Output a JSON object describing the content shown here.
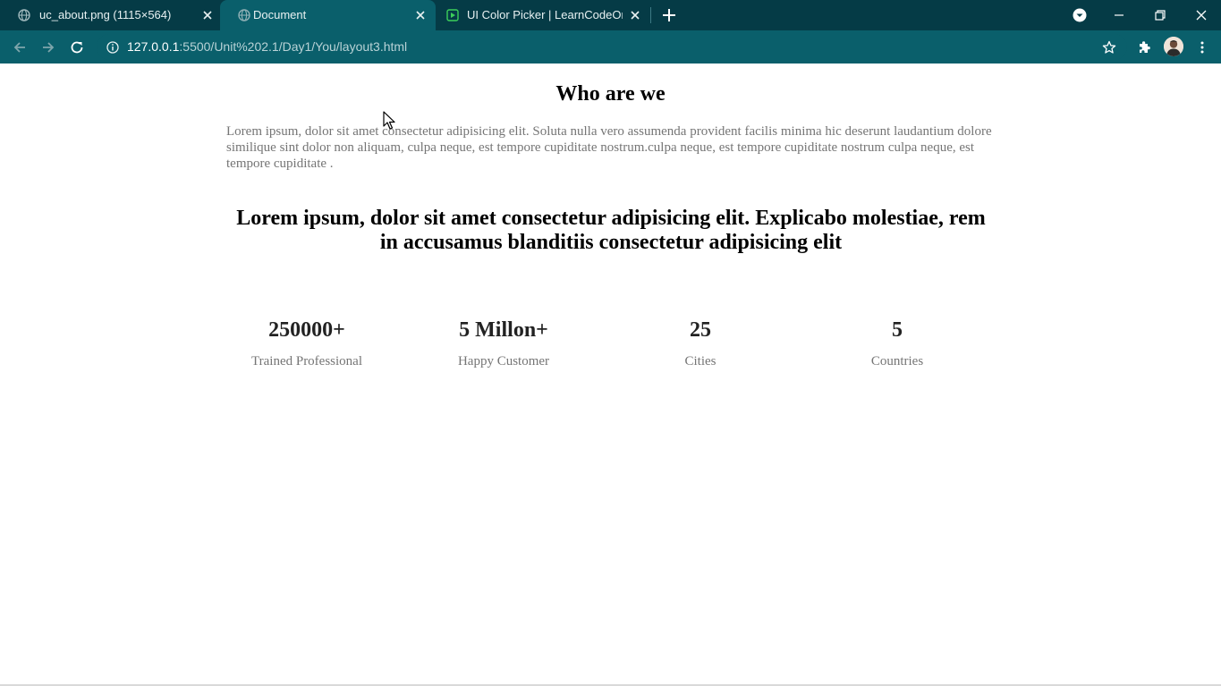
{
  "tabs": [
    {
      "title": "uc_about.png (1115×564)",
      "active": false
    },
    {
      "title": "Document",
      "active": true
    },
    {
      "title": "UI Color Picker | LearnCodeOnline",
      "active": false
    }
  ],
  "address_bar": {
    "host": "127.0.0.1",
    "path": ":5500/Unit%202.1/Day1/You/layout3.html"
  },
  "page": {
    "title": "Who are we",
    "intro": "Lorem ipsum, dolor sit amet consectetur adipisicing elit. Soluta nulla vero assumenda provident facilis minima hic deserunt laudantium dolore similique sint dolor non aliquam, culpa neque, est tempore cupiditate nostrum.culpa neque, est tempore cupiditate nostrum culpa neque, est tempore cupiditate .",
    "headline": "Lorem ipsum, dolor sit amet consectetur adipisicing elit. Explicabo molestiae, rem in accusamus blanditiis consectetur adipisicing elit",
    "stats": [
      {
        "value": "250000+",
        "label": "Trained Professional"
      },
      {
        "value": "5 Millon+",
        "label": "Happy Customer"
      },
      {
        "value": "25",
        "label": "Cities"
      },
      {
        "value": "5",
        "label": "Countries"
      }
    ]
  },
  "colors": {
    "tabbar": "#053b46",
    "toolbar": "#0a5f6b",
    "muted_text": "#757575"
  }
}
